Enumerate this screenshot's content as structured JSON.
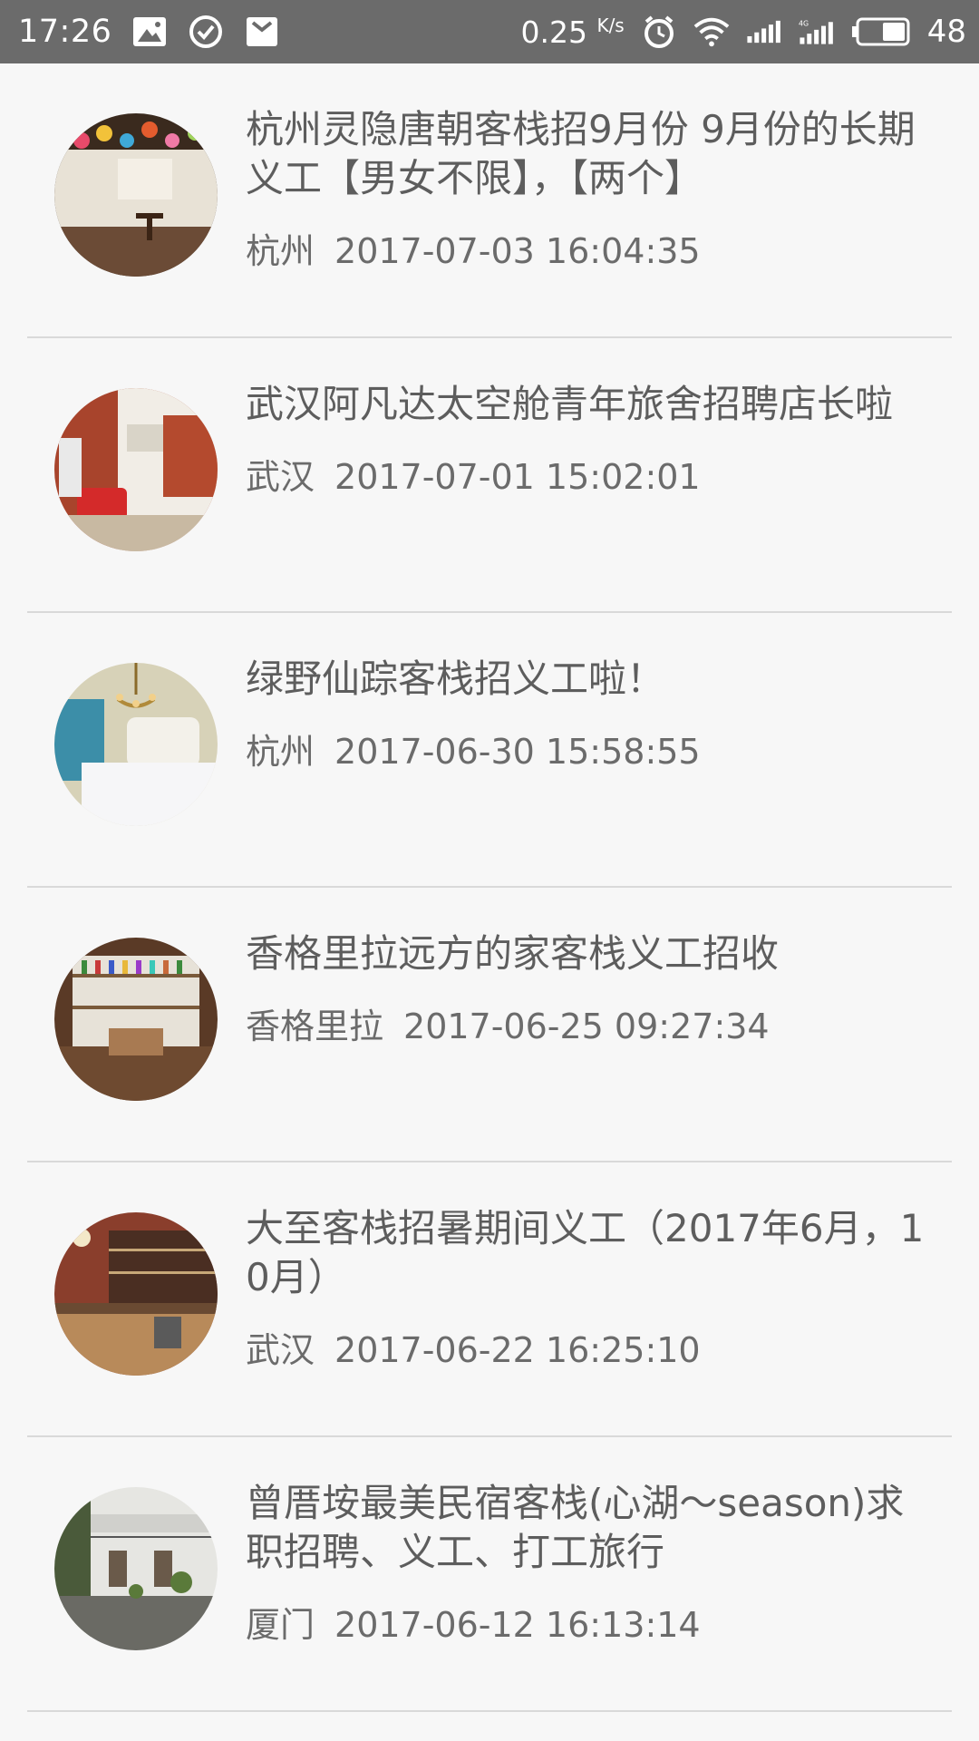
{
  "status_bar": {
    "time": "17:26",
    "speed_value": "0.25",
    "speed_unit": "K/s",
    "battery": "48",
    "icons": [
      "image-notification-icon",
      "check-circle-icon",
      "mail-bag-icon",
      "alarm-icon",
      "wifi-icon",
      "signal-icon",
      "signal-4g-icon",
      "battery-icon"
    ]
  },
  "listings": [
    {
      "title": "杭州灵隐唐朝客栈招9月份 9月份的长期义工【男女不限】，【两个】",
      "location": "杭州",
      "datetime": "2017-07-03 16:04:35",
      "thumb": "cafe-lanterns"
    },
    {
      "title": "武汉阿凡达太空舱青年旅舍招聘店长啦",
      "location": "武汉",
      "datetime": "2017-07-01 15:02:01",
      "thumb": "brick-red-sofa"
    },
    {
      "title": "绿野仙踪客栈招义工啦！",
      "location": "杭州",
      "datetime": "2017-06-30 15:58:55",
      "thumb": "bedroom-chandelier"
    },
    {
      "title": "香格里拉远方的家客栈义工招收",
      "location": "香格里拉",
      "datetime": "2017-06-25 09:27:34",
      "thumb": "bar-shelves"
    },
    {
      "title": "大至客栈招暑期间义工（2017年6月，10月）",
      "location": "武汉",
      "datetime": "2017-06-22 16:25:10",
      "thumb": "brick-bar-counter"
    },
    {
      "title": "曾厝垵最美民宿客栈(心湖～season)求职招聘、义工、打工旅行",
      "location": "厦门",
      "datetime": "2017-06-12 16:13:14",
      "thumb": "courtyard"
    }
  ]
}
